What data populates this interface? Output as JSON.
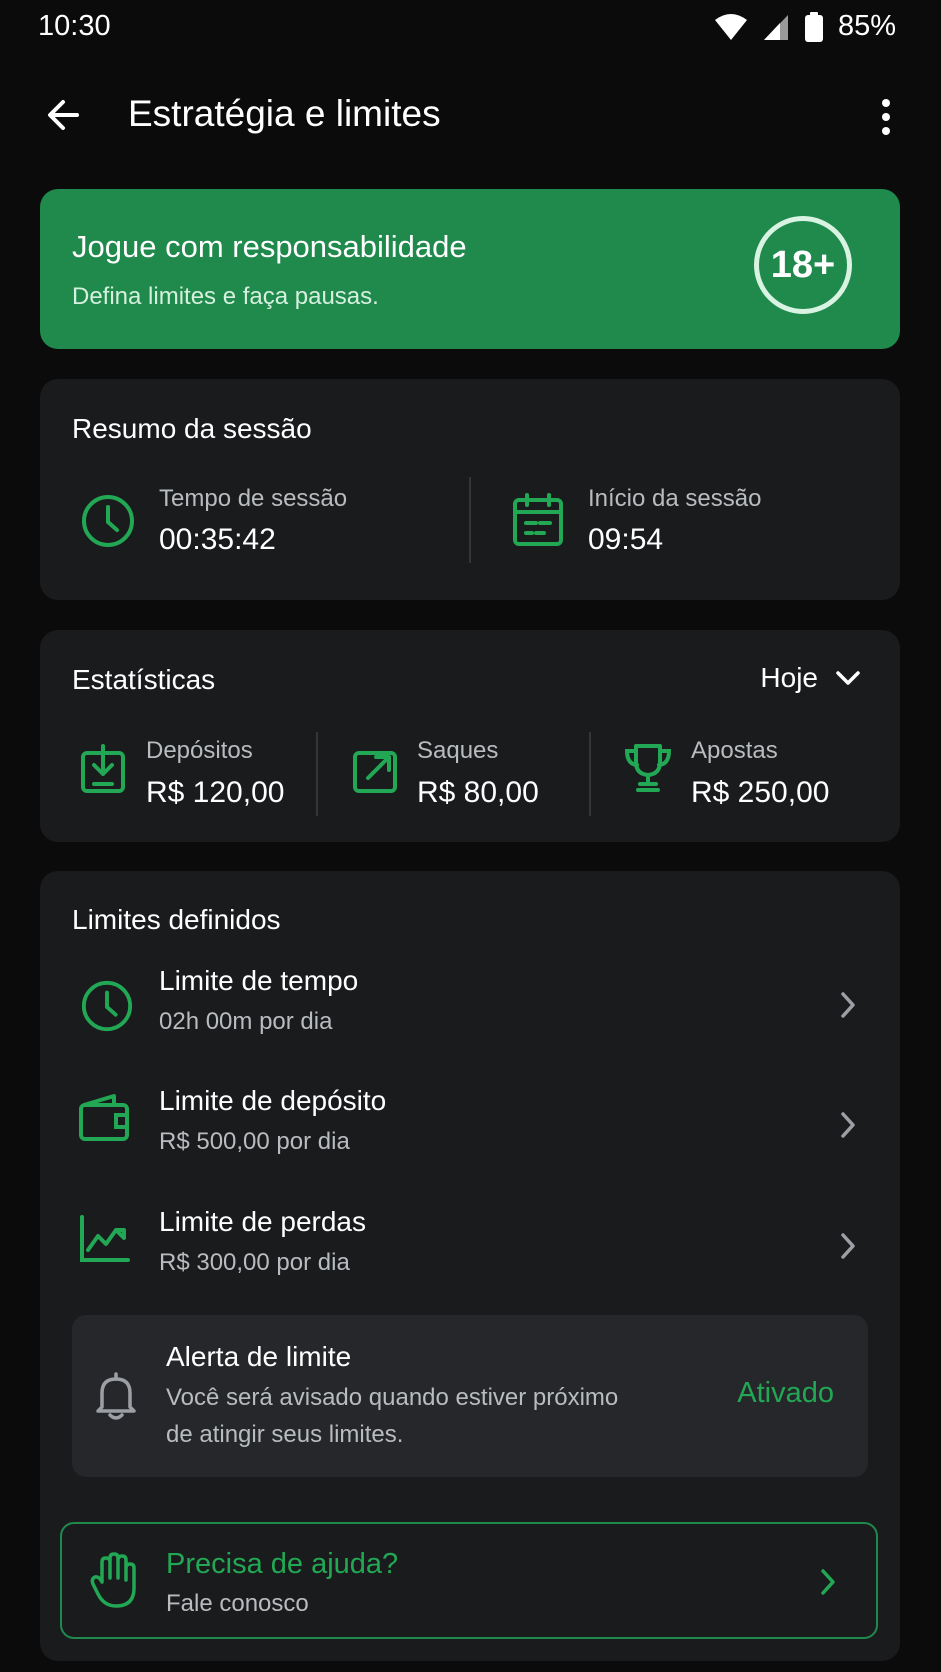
{
  "status_bar": {
    "time": "10:30",
    "battery": "85%"
  },
  "app_bar": {
    "title": "Estratégia e limites"
  },
  "banner": {
    "title": "Jogue com responsabilidade",
    "subtitle": "Defina limites e faça pausas.",
    "badge": "18+"
  },
  "session": {
    "title": "Resumo da sessão",
    "time_label": "Tempo de sessão",
    "time_value": "00:35:42",
    "start_label": "Início da sessão",
    "start_value": "09:54"
  },
  "stats": {
    "title": "Estatísticas",
    "period": "Hoje",
    "items": [
      {
        "label": "Depósitos",
        "value": "R$ 120,00",
        "icon": "deposit-icon"
      },
      {
        "label": "Saques",
        "value": "R$ 80,00",
        "icon": "withdraw-icon"
      },
      {
        "label": "Apostas",
        "value": "R$ 250,00",
        "icon": "trophy-icon"
      }
    ]
  },
  "limits": {
    "title": "Limites definidos",
    "items": [
      {
        "title": "Limite de tempo",
        "subtitle": "02h 00m por dia",
        "icon": "clock-icon"
      },
      {
        "title": "Limite de depósito",
        "subtitle": "R$ 500,00 por dia",
        "icon": "wallet-icon"
      },
      {
        "title": "Limite de perdas",
        "subtitle": "R$ 300,00 por dia",
        "icon": "chart-icon"
      }
    ],
    "alert": {
      "title": "Alerta de limite",
      "line1": "Você será avisado quando estiver próximo",
      "line2": "de atingir seus limites.",
      "status": "Ativado"
    }
  },
  "help": {
    "title": "Precisa de ajuda?",
    "subtitle": "Fale conosco"
  },
  "colors": {
    "accent": "#22a854",
    "banner": "#1f8a4c",
    "card": "#1a1b1d",
    "background": "#0b0b0c"
  }
}
